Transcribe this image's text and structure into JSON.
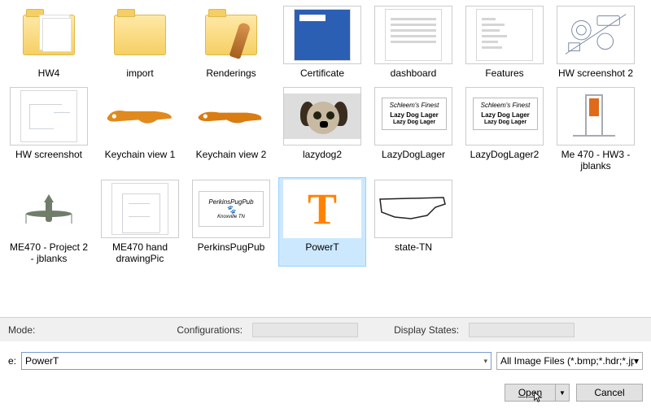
{
  "files": {
    "row1": [
      {
        "label": "HW4",
        "kind": "folder-docs"
      },
      {
        "label": "import",
        "kind": "folder"
      },
      {
        "label": "Renderings",
        "kind": "folder-render"
      },
      {
        "label": "Certificate",
        "kind": "bluedoc"
      },
      {
        "label": "dashboard",
        "kind": "doclines"
      },
      {
        "label": "Features",
        "kind": "featuredoc"
      },
      {
        "label": "HW screenshot 2",
        "kind": "exploded"
      }
    ],
    "row2": [
      {
        "label": "HW screenshot",
        "kind": "sketch"
      },
      {
        "label": "Keychain view 1",
        "kind": "keychain1"
      },
      {
        "label": "Keychain view 2",
        "kind": "keychain2"
      },
      {
        "label": "lazydog2",
        "kind": "dog"
      },
      {
        "label": "LazyDogLager",
        "kind": "lazylabel"
      },
      {
        "label": "LazyDogLager2",
        "kind": "lazylabel"
      },
      {
        "label": "Me 470 - HW3 - jblanks",
        "kind": "hinge"
      }
    ],
    "row3": [
      {
        "label": "ME470 - Project 2 - jblanks",
        "kind": "plane"
      },
      {
        "label": "ME470 hand drawingPic",
        "kind": "handdraw"
      },
      {
        "label": "PerkinsPugPub",
        "kind": "pug"
      },
      {
        "label": "PowerT",
        "kind": "powert",
        "selected": true
      },
      {
        "label": "state-TN",
        "kind": "tn"
      }
    ]
  },
  "options": {
    "mode_label": "Mode:",
    "config_label": "Configurations:",
    "display_label": "Display States:"
  },
  "footer": {
    "filename_label": "e:",
    "filename_value": "PowerT",
    "type_value": "All Image Files (*.bmp;*.hdr;*.jpg",
    "open_label": "Open",
    "cancel_label": "Cancel"
  },
  "beerlabel": {
    "t1": "Schleem's Finest",
    "t2": "Lazy Dog Lager",
    "t3": "Lazy Dog Lager"
  }
}
